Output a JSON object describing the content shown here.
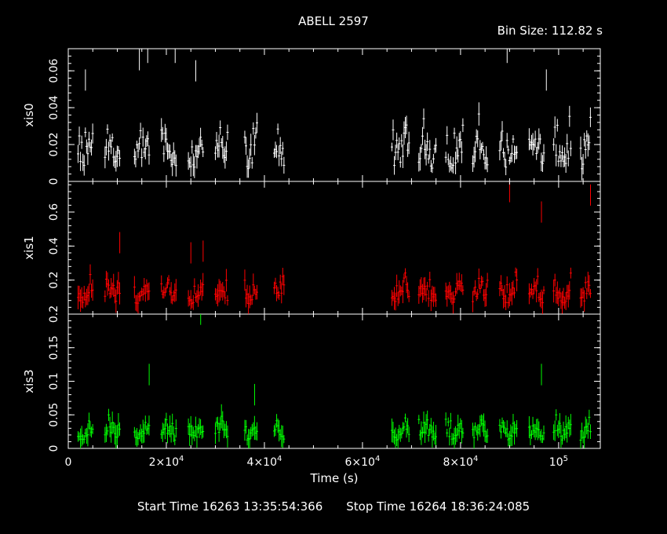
{
  "header": {
    "title": "ABELL 2597",
    "bin_size": "Bin Size: 112.82 s"
  },
  "footer": {
    "start_time": "Start Time 16263 13:35:54:366",
    "stop_time": "Stop Time 16264 18:36:24:085"
  },
  "chart_data": [
    {
      "type": "scatter",
      "title": "ABELL 2597",
      "xlabel": "Time (s)",
      "ylabel": "xis0",
      "color": "#ffffff",
      "xlim": [
        0,
        108500
      ],
      "ylim": [
        0,
        0.072
      ],
      "yticks": [
        0,
        0.02,
        0.04,
        0.06
      ],
      "ytick_labels": [
        "0",
        "0.02",
        "0.04",
        "0.06"
      ],
      "observation_windows": [
        [
          2000,
          5000
        ],
        [
          7500,
          10500
        ],
        [
          13500,
          16500
        ],
        [
          19000,
          22000
        ],
        [
          24500,
          27500
        ],
        [
          30000,
          32500
        ],
        [
          36000,
          38500
        ],
        [
          42000,
          44000
        ],
        [
          66000,
          69500
        ],
        [
          71500,
          75000
        ],
        [
          77000,
          80500
        ],
        [
          82500,
          85500
        ],
        [
          88000,
          91500
        ],
        [
          94000,
          97000
        ],
        [
          99000,
          102500
        ],
        [
          104500,
          106500
        ]
      ],
      "typical_range": [
        0.005,
        0.035
      ],
      "peaks": [
        {
          "x": 3500,
          "y": 0.055
        },
        {
          "x": 14500,
          "y": 0.066
        },
        {
          "x": 16200,
          "y": 0.07
        },
        {
          "x": 21800,
          "y": 0.07
        },
        {
          "x": 26000,
          "y": 0.06
        },
        {
          "x": 89500,
          "y": 0.07
        },
        {
          "x": 97500,
          "y": 0.055
        }
      ],
      "errorbars": true
    },
    {
      "type": "scatter",
      "ylabel": "xis1",
      "color": "#ff0000",
      "xlim": [
        0,
        108500
      ],
      "ylim": [
        0,
        0.78
      ],
      "yticks": [
        0.2,
        0.4,
        0.6
      ],
      "ytick_labels": [
        "0.2",
        "0.4",
        "0.6"
      ],
      "typical_range": [
        0.05,
        0.25
      ],
      "peaks": [
        {
          "x": 10500,
          "y": 0.42
        },
        {
          "x": 25000,
          "y": 0.36
        },
        {
          "x": 27500,
          "y": 0.37
        },
        {
          "x": 90000,
          "y": 0.72
        },
        {
          "x": 96500,
          "y": 0.6
        },
        {
          "x": 106500,
          "y": 0.7
        }
      ],
      "errorbars": true
    },
    {
      "type": "scatter",
      "ylabel": "xis3",
      "color": "#00ff00",
      "xlim": [
        0,
        108500
      ],
      "xticks": [
        0,
        20000,
        40000,
        60000,
        80000,
        100000
      ],
      "xtick_labels": [
        [
          "0",
          ""
        ],
        [
          "2×10",
          "4"
        ],
        [
          "4×10",
          "4"
        ],
        [
          "6×10",
          "4"
        ],
        [
          "8×10",
          "4"
        ],
        [
          "10",
          "5"
        ]
      ],
      "ylim": [
        0,
        0.2
      ],
      "yticks": [
        0,
        0.05,
        0.1,
        0.15,
        0.2
      ],
      "ytick_labels": [
        "0",
        "0.05",
        "0.1",
        "0.15",
        "0.2"
      ],
      "typical_range": [
        0.01,
        0.05
      ],
      "peaks": [
        {
          "x": 16500,
          "y": 0.11
        },
        {
          "x": 27000,
          "y": 0.2
        },
        {
          "x": 38000,
          "y": 0.08
        },
        {
          "x": 96500,
          "y": 0.11
        }
      ],
      "errorbars": true
    }
  ]
}
